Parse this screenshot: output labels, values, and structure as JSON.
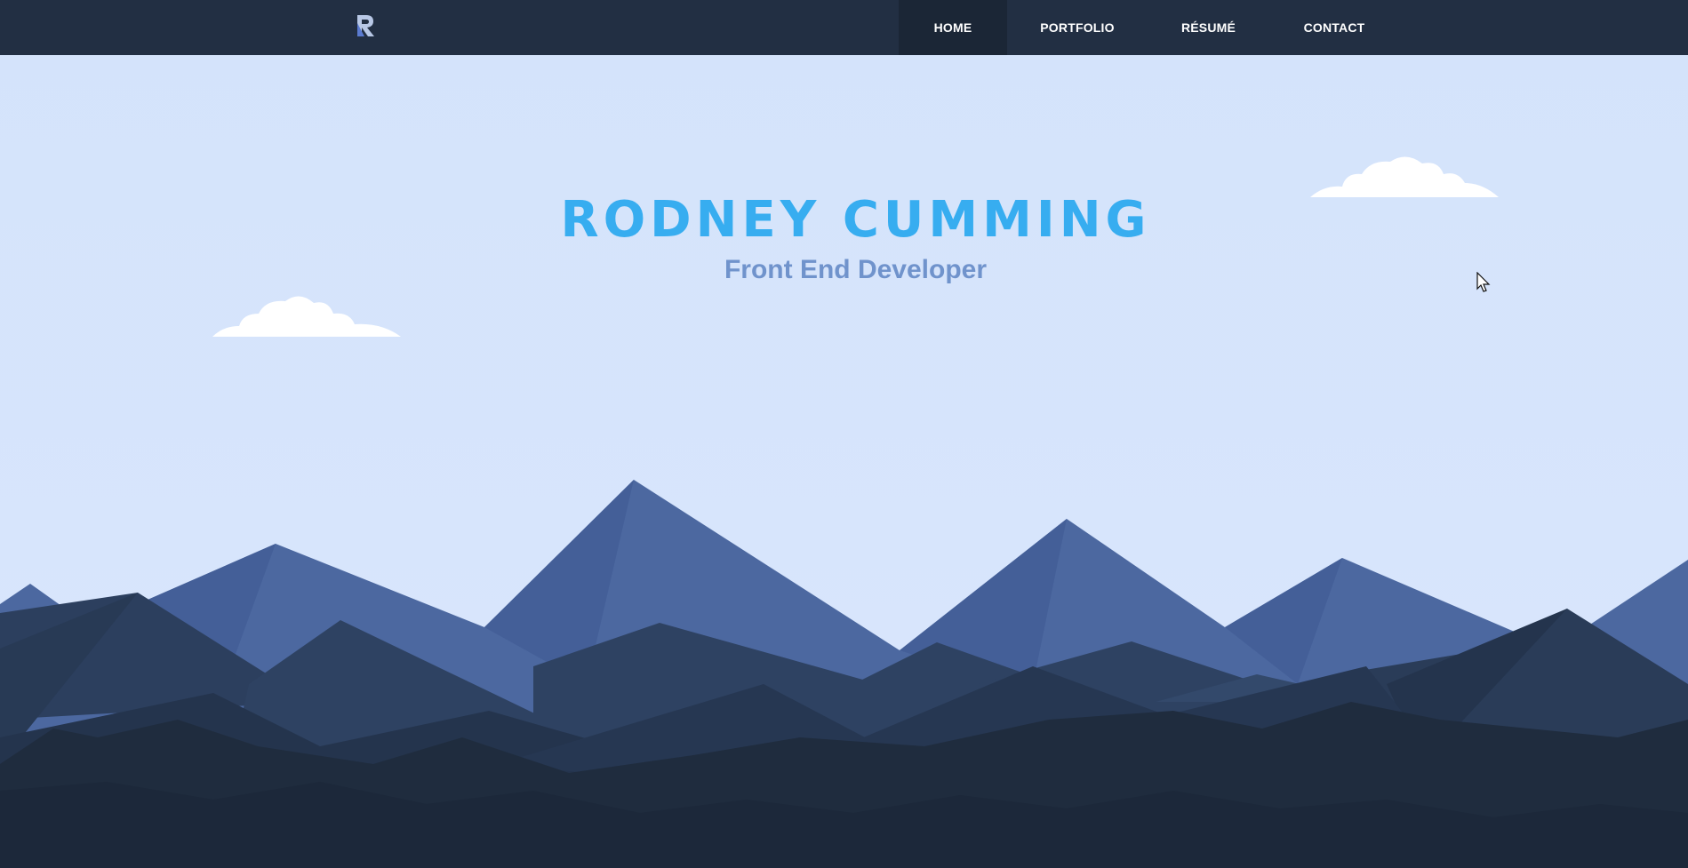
{
  "header": {
    "logo_letter": "R",
    "nav": [
      {
        "label": "HOME",
        "active": true
      },
      {
        "label": "PORTFOLIO",
        "active": false
      },
      {
        "label": "RÉSUMÉ",
        "active": false
      },
      {
        "label": "CONTACT",
        "active": false
      }
    ]
  },
  "hero": {
    "name": "RODNEY CUMMING",
    "role": "Front End Developer"
  },
  "colors": {
    "navbar": "#222f43",
    "active_tab": "#1b2636",
    "sky": "#d7e5fc",
    "name_accent": "#37adf0",
    "role_text": "#7093cc"
  },
  "icons": [
    "logo-r-icon",
    "cloud-icon",
    "mouse-pointer-icon"
  ]
}
